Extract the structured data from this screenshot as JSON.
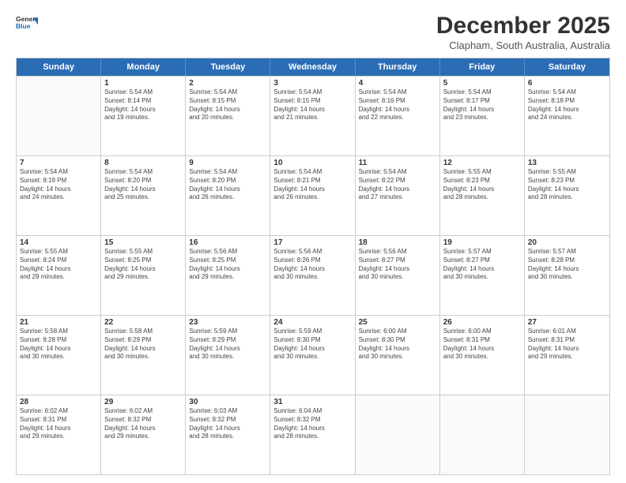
{
  "header": {
    "logo_line1": "General",
    "logo_line2": "Blue",
    "month": "December 2025",
    "location": "Clapham, South Australia, Australia"
  },
  "days_of_week": [
    "Sunday",
    "Monday",
    "Tuesday",
    "Wednesday",
    "Thursday",
    "Friday",
    "Saturday"
  ],
  "weeks": [
    [
      {
        "day": "",
        "sunrise": "",
        "sunset": "",
        "daylight": ""
      },
      {
        "day": "1",
        "sunrise": "Sunrise: 5:54 AM",
        "sunset": "Sunset: 8:14 PM",
        "daylight": "Daylight: 14 hours and 19 minutes."
      },
      {
        "day": "2",
        "sunrise": "Sunrise: 5:54 AM",
        "sunset": "Sunset: 8:15 PM",
        "daylight": "Daylight: 14 hours and 20 minutes."
      },
      {
        "day": "3",
        "sunrise": "Sunrise: 5:54 AM",
        "sunset": "Sunset: 8:15 PM",
        "daylight": "Daylight: 14 hours and 21 minutes."
      },
      {
        "day": "4",
        "sunrise": "Sunrise: 5:54 AM",
        "sunset": "Sunset: 8:16 PM",
        "daylight": "Daylight: 14 hours and 22 minutes."
      },
      {
        "day": "5",
        "sunrise": "Sunrise: 5:54 AM",
        "sunset": "Sunset: 8:17 PM",
        "daylight": "Daylight: 14 hours and 23 minutes."
      },
      {
        "day": "6",
        "sunrise": "Sunrise: 5:54 AM",
        "sunset": "Sunset: 8:18 PM",
        "daylight": "Daylight: 14 hours and 24 minutes."
      }
    ],
    [
      {
        "day": "7",
        "sunrise": "Sunrise: 5:54 AM",
        "sunset": "Sunset: 8:19 PM",
        "daylight": "Daylight: 14 hours and 24 minutes."
      },
      {
        "day": "8",
        "sunrise": "Sunrise: 5:54 AM",
        "sunset": "Sunset: 8:20 PM",
        "daylight": "Daylight: 14 hours and 25 minutes."
      },
      {
        "day": "9",
        "sunrise": "Sunrise: 5:54 AM",
        "sunset": "Sunset: 8:20 PM",
        "daylight": "Daylight: 14 hours and 26 minutes."
      },
      {
        "day": "10",
        "sunrise": "Sunrise: 5:54 AM",
        "sunset": "Sunset: 8:21 PM",
        "daylight": "Daylight: 14 hours and 26 minutes."
      },
      {
        "day": "11",
        "sunrise": "Sunrise: 5:54 AM",
        "sunset": "Sunset: 8:22 PM",
        "daylight": "Daylight: 14 hours and 27 minutes."
      },
      {
        "day": "12",
        "sunrise": "Sunrise: 5:55 AM",
        "sunset": "Sunset: 8:23 PM",
        "daylight": "Daylight: 14 hours and 28 minutes."
      },
      {
        "day": "13",
        "sunrise": "Sunrise: 5:55 AM",
        "sunset": "Sunset: 8:23 PM",
        "daylight": "Daylight: 14 hours and 28 minutes."
      }
    ],
    [
      {
        "day": "14",
        "sunrise": "Sunrise: 5:55 AM",
        "sunset": "Sunset: 8:24 PM",
        "daylight": "Daylight: 14 hours and 29 minutes."
      },
      {
        "day": "15",
        "sunrise": "Sunrise: 5:55 AM",
        "sunset": "Sunset: 8:25 PM",
        "daylight": "Daylight: 14 hours and 29 minutes."
      },
      {
        "day": "16",
        "sunrise": "Sunrise: 5:56 AM",
        "sunset": "Sunset: 8:25 PM",
        "daylight": "Daylight: 14 hours and 29 minutes."
      },
      {
        "day": "17",
        "sunrise": "Sunrise: 5:56 AM",
        "sunset": "Sunset: 8:26 PM",
        "daylight": "Daylight: 14 hours and 30 minutes."
      },
      {
        "day": "18",
        "sunrise": "Sunrise: 5:56 AM",
        "sunset": "Sunset: 8:27 PM",
        "daylight": "Daylight: 14 hours and 30 minutes."
      },
      {
        "day": "19",
        "sunrise": "Sunrise: 5:57 AM",
        "sunset": "Sunset: 8:27 PM",
        "daylight": "Daylight: 14 hours and 30 minutes."
      },
      {
        "day": "20",
        "sunrise": "Sunrise: 5:57 AM",
        "sunset": "Sunset: 8:28 PM",
        "daylight": "Daylight: 14 hours and 30 minutes."
      }
    ],
    [
      {
        "day": "21",
        "sunrise": "Sunrise: 5:58 AM",
        "sunset": "Sunset: 8:28 PM",
        "daylight": "Daylight: 14 hours and 30 minutes."
      },
      {
        "day": "22",
        "sunrise": "Sunrise: 5:58 AM",
        "sunset": "Sunset: 8:29 PM",
        "daylight": "Daylight: 14 hours and 30 minutes."
      },
      {
        "day": "23",
        "sunrise": "Sunrise: 5:59 AM",
        "sunset": "Sunset: 8:29 PM",
        "daylight": "Daylight: 14 hours and 30 minutes."
      },
      {
        "day": "24",
        "sunrise": "Sunrise: 5:59 AM",
        "sunset": "Sunset: 8:30 PM",
        "daylight": "Daylight: 14 hours and 30 minutes."
      },
      {
        "day": "25",
        "sunrise": "Sunrise: 6:00 AM",
        "sunset": "Sunset: 8:30 PM",
        "daylight": "Daylight: 14 hours and 30 minutes."
      },
      {
        "day": "26",
        "sunrise": "Sunrise: 6:00 AM",
        "sunset": "Sunset: 8:31 PM",
        "daylight": "Daylight: 14 hours and 30 minutes."
      },
      {
        "day": "27",
        "sunrise": "Sunrise: 6:01 AM",
        "sunset": "Sunset: 8:31 PM",
        "daylight": "Daylight: 14 hours and 29 minutes."
      }
    ],
    [
      {
        "day": "28",
        "sunrise": "Sunrise: 6:02 AM",
        "sunset": "Sunset: 8:31 PM",
        "daylight": "Daylight: 14 hours and 29 minutes."
      },
      {
        "day": "29",
        "sunrise": "Sunrise: 6:02 AM",
        "sunset": "Sunset: 8:32 PM",
        "daylight": "Daylight: 14 hours and 29 minutes."
      },
      {
        "day": "30",
        "sunrise": "Sunrise: 6:03 AM",
        "sunset": "Sunset: 8:32 PM",
        "daylight": "Daylight: 14 hours and 28 minutes."
      },
      {
        "day": "31",
        "sunrise": "Sunrise: 6:04 AM",
        "sunset": "Sunset: 8:32 PM",
        "daylight": "Daylight: 14 hours and 28 minutes."
      },
      {
        "day": "",
        "sunrise": "",
        "sunset": "",
        "daylight": ""
      },
      {
        "day": "",
        "sunrise": "",
        "sunset": "",
        "daylight": ""
      },
      {
        "day": "",
        "sunrise": "",
        "sunset": "",
        "daylight": ""
      }
    ]
  ]
}
